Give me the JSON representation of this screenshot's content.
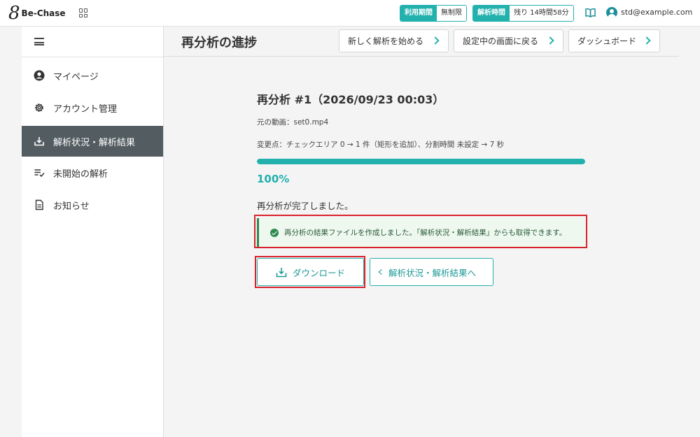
{
  "app": {
    "logo_mark": "8",
    "logo_text": "Be-Chase"
  },
  "topbar": {
    "usage_period_label": "利用期間",
    "usage_period_value": "無制限",
    "analysis_time_label": "解析時間",
    "analysis_time_value": "残り 14時間58分",
    "user_email": "std@example.com"
  },
  "sidebar": {
    "items": [
      {
        "label": "マイページ",
        "icon": "user-circle-icon"
      },
      {
        "label": "アカウント管理",
        "icon": "gear-icon"
      },
      {
        "label": "解析状況・解析結果",
        "icon": "download-tray-icon",
        "active": true
      },
      {
        "label": "未開始の解析",
        "icon": "list-check-icon"
      },
      {
        "label": "お知らせ",
        "icon": "document-icon"
      }
    ]
  },
  "header": {
    "title": "再分析の進捗",
    "buttons": [
      "新しく解析を始める",
      "設定中の画面に戻る",
      "ダッシュボード"
    ]
  },
  "main": {
    "job_title": "再分析 #1（2026/09/23 00:03）",
    "source_video": "元の動画：set0.mp4",
    "changes": "変更点：チェックエリア 0 → 1 件（矩形を追加）、分割時間 未設定 → 7 秒",
    "progress": 1.0,
    "progress_text": "100%",
    "status_text": "再分析が完了しました。",
    "alert_text": "再分析の結果ファイルを作成しました。「解析状況・解析結果」からも取得できます。",
    "download_label": "ダウンロード",
    "back_label": "解析状況・解析結果へ"
  },
  "colors": {
    "accent": "#23b1ad",
    "active_nav": "#535d61",
    "success": "#2e8a4f",
    "highlight": "#d8232a"
  }
}
